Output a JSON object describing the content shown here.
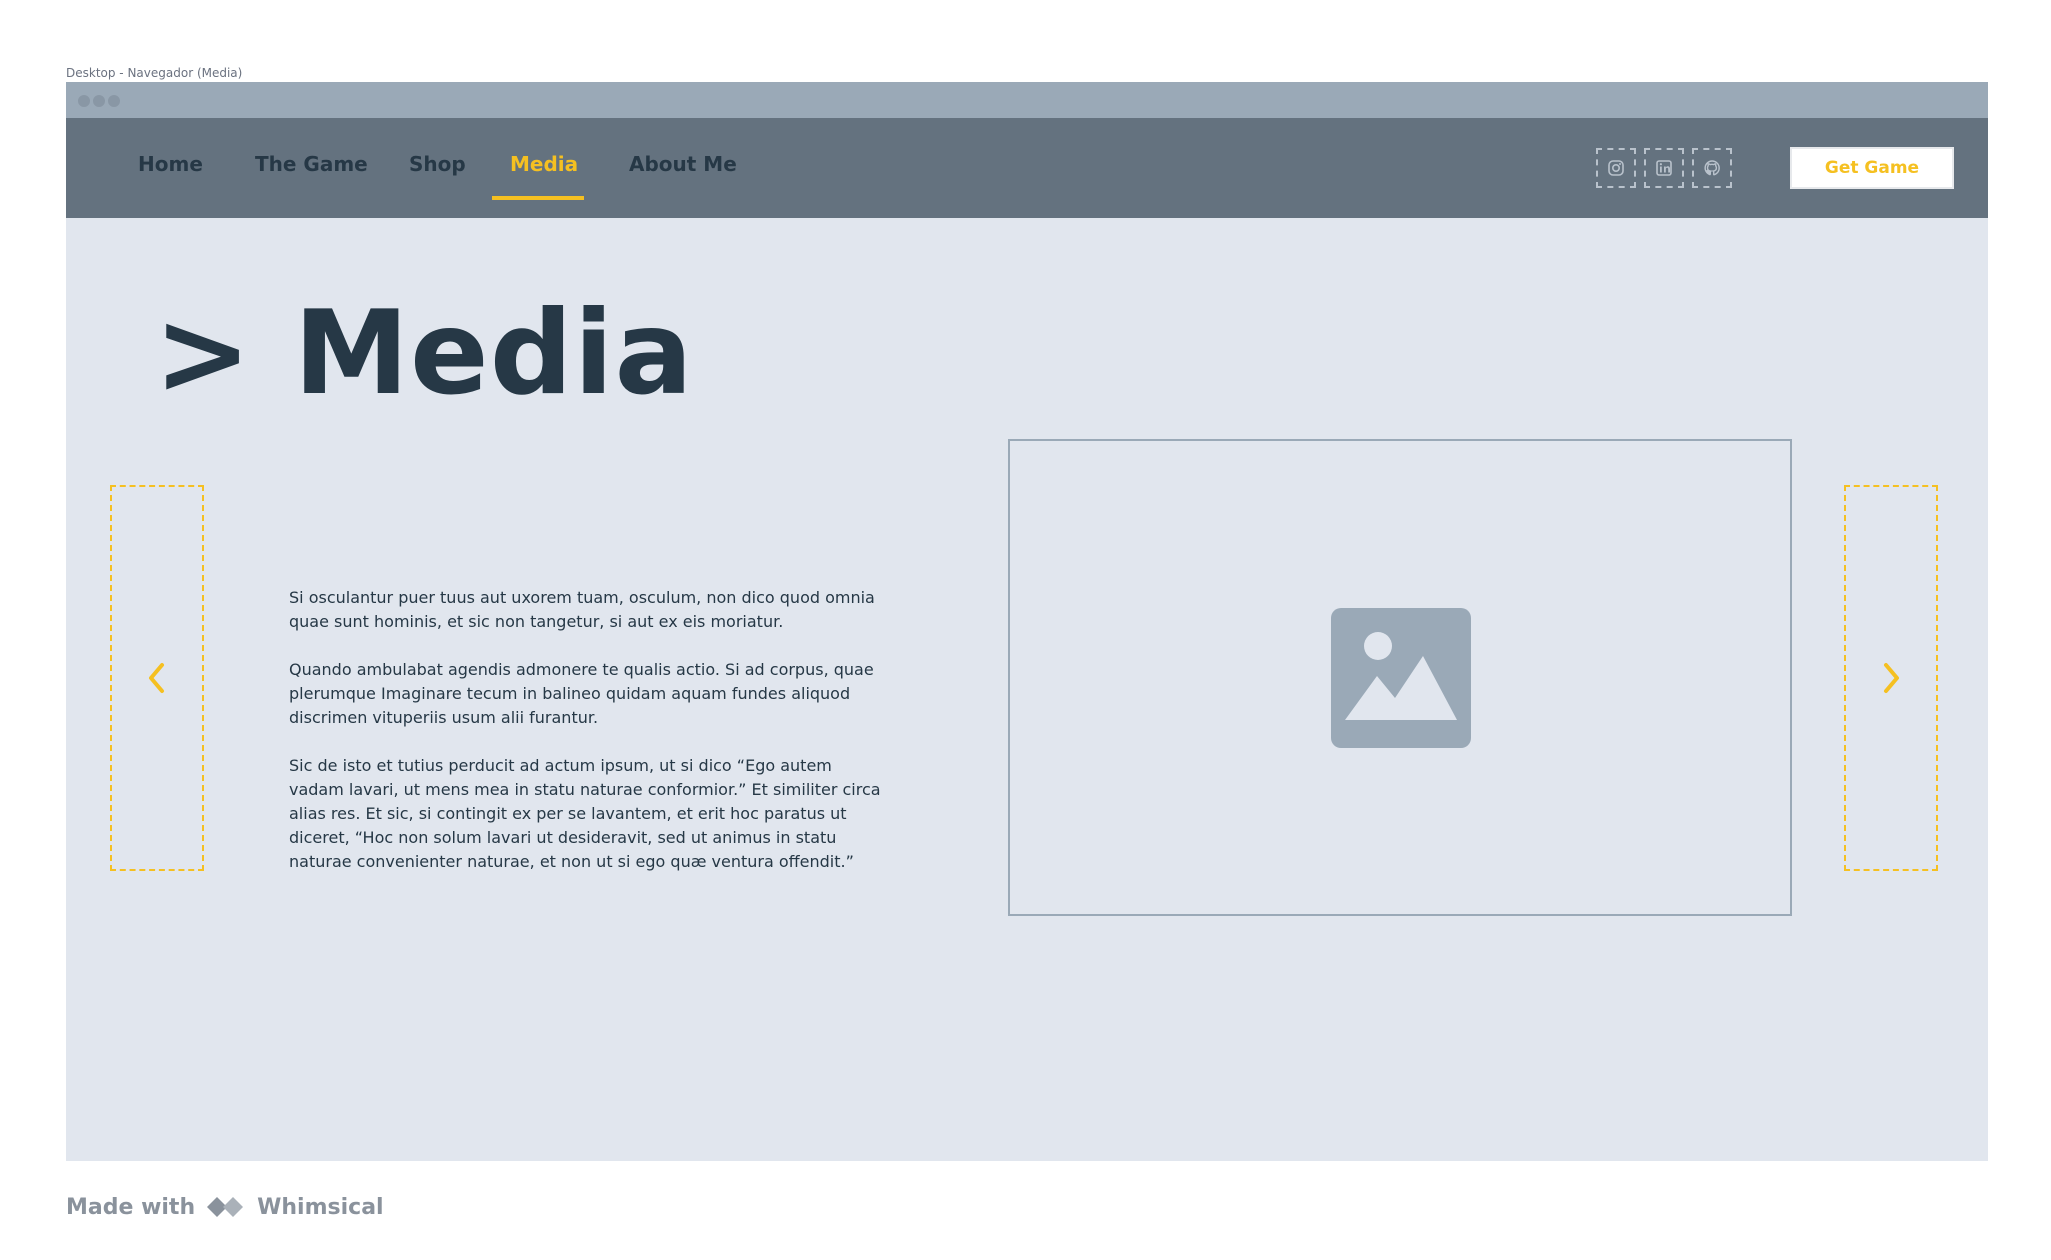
{
  "frame_label": "Desktop - Navegador (Media)",
  "nav": {
    "items": [
      {
        "label": "Home",
        "active": false
      },
      {
        "label": "The Game",
        "active": false
      },
      {
        "label": "Shop",
        "active": false
      },
      {
        "label": "Media",
        "active": true
      },
      {
        "label": "About Me",
        "active": false
      }
    ],
    "social": [
      {
        "icon": "instagram-icon"
      },
      {
        "icon": "linkedin-icon"
      },
      {
        "icon": "github-icon"
      }
    ],
    "cta_label": "Get Game"
  },
  "page": {
    "title": "> Media",
    "paragraphs": [
      "Si osculantur puer tuus aut uxorem tuam, osculum, non dico quod omnia quae sunt hominis, et sic non tangetur, si aut ex eis moriatur.",
      "Quando ambulabat agendis admonere te qualis actio. Si ad corpus, quae plerumque Imaginare tecum in balineo quidam aquam fundes aliquod discrimen vituperiis usum alii furantur.",
      "Sic de isto et tutius perducit ad actum ipsum, ut si dico “Ego autem vadam lavari, ut mens mea in statu naturae conformior.” Et similiter circa alias res. Et sic, si contingit ex per se lavantem, et erit hoc paratus ut diceret, “Hoc non solum lavari ut desideravit, sed ut animus in statu naturae convenienter naturae, et non ut si ego quæ ventura offendit.”"
    ],
    "prev_icon": "chevron-left-icon",
    "next_icon": "chevron-right-icon",
    "media_icon": "image-placeholder-icon"
  },
  "footer": {
    "made_with": "Made with",
    "brand": "Whimsical"
  },
  "colors": {
    "accent": "#f5c021",
    "nav_bg": "#64727f",
    "page_bg": "#e1e6ee",
    "text_dark": "#263846"
  }
}
